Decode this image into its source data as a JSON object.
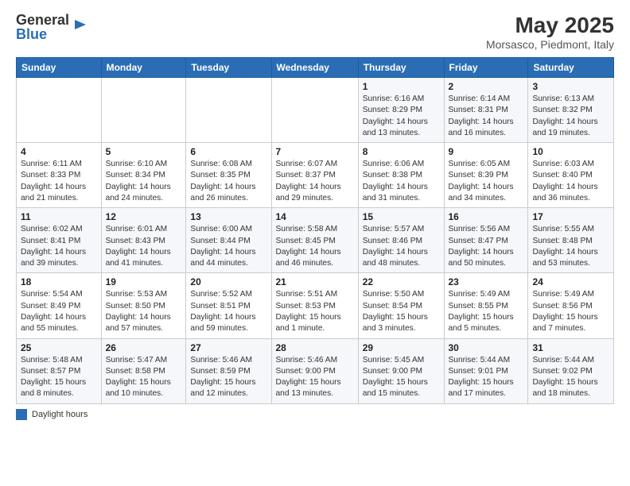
{
  "logo": {
    "general": "General",
    "blue": "Blue"
  },
  "header": {
    "title": "May 2025",
    "subtitle": "Morsasco, Piedmont, Italy"
  },
  "weekdays": [
    "Sunday",
    "Monday",
    "Tuesday",
    "Wednesday",
    "Thursday",
    "Friday",
    "Saturday"
  ],
  "weeks": [
    [
      {
        "date": "",
        "info": ""
      },
      {
        "date": "",
        "info": ""
      },
      {
        "date": "",
        "info": ""
      },
      {
        "date": "",
        "info": ""
      },
      {
        "date": "1",
        "info": "Sunrise: 6:16 AM\nSunset: 8:29 PM\nDaylight: 14 hours and 13 minutes."
      },
      {
        "date": "2",
        "info": "Sunrise: 6:14 AM\nSunset: 8:31 PM\nDaylight: 14 hours and 16 minutes."
      },
      {
        "date": "3",
        "info": "Sunrise: 6:13 AM\nSunset: 8:32 PM\nDaylight: 14 hours and 19 minutes."
      }
    ],
    [
      {
        "date": "4",
        "info": "Sunrise: 6:11 AM\nSunset: 8:33 PM\nDaylight: 14 hours and 21 minutes."
      },
      {
        "date": "5",
        "info": "Sunrise: 6:10 AM\nSunset: 8:34 PM\nDaylight: 14 hours and 24 minutes."
      },
      {
        "date": "6",
        "info": "Sunrise: 6:08 AM\nSunset: 8:35 PM\nDaylight: 14 hours and 26 minutes."
      },
      {
        "date": "7",
        "info": "Sunrise: 6:07 AM\nSunset: 8:37 PM\nDaylight: 14 hours and 29 minutes."
      },
      {
        "date": "8",
        "info": "Sunrise: 6:06 AM\nSunset: 8:38 PM\nDaylight: 14 hours and 31 minutes."
      },
      {
        "date": "9",
        "info": "Sunrise: 6:05 AM\nSunset: 8:39 PM\nDaylight: 14 hours and 34 minutes."
      },
      {
        "date": "10",
        "info": "Sunrise: 6:03 AM\nSunset: 8:40 PM\nDaylight: 14 hours and 36 minutes."
      }
    ],
    [
      {
        "date": "11",
        "info": "Sunrise: 6:02 AM\nSunset: 8:41 PM\nDaylight: 14 hours and 39 minutes."
      },
      {
        "date": "12",
        "info": "Sunrise: 6:01 AM\nSunset: 8:43 PM\nDaylight: 14 hours and 41 minutes."
      },
      {
        "date": "13",
        "info": "Sunrise: 6:00 AM\nSunset: 8:44 PM\nDaylight: 14 hours and 44 minutes."
      },
      {
        "date": "14",
        "info": "Sunrise: 5:58 AM\nSunset: 8:45 PM\nDaylight: 14 hours and 46 minutes."
      },
      {
        "date": "15",
        "info": "Sunrise: 5:57 AM\nSunset: 8:46 PM\nDaylight: 14 hours and 48 minutes."
      },
      {
        "date": "16",
        "info": "Sunrise: 5:56 AM\nSunset: 8:47 PM\nDaylight: 14 hours and 50 minutes."
      },
      {
        "date": "17",
        "info": "Sunrise: 5:55 AM\nSunset: 8:48 PM\nDaylight: 14 hours and 53 minutes."
      }
    ],
    [
      {
        "date": "18",
        "info": "Sunrise: 5:54 AM\nSunset: 8:49 PM\nDaylight: 14 hours and 55 minutes."
      },
      {
        "date": "19",
        "info": "Sunrise: 5:53 AM\nSunset: 8:50 PM\nDaylight: 14 hours and 57 minutes."
      },
      {
        "date": "20",
        "info": "Sunrise: 5:52 AM\nSunset: 8:51 PM\nDaylight: 14 hours and 59 minutes."
      },
      {
        "date": "21",
        "info": "Sunrise: 5:51 AM\nSunset: 8:53 PM\nDaylight: 15 hours and 1 minute."
      },
      {
        "date": "22",
        "info": "Sunrise: 5:50 AM\nSunset: 8:54 PM\nDaylight: 15 hours and 3 minutes."
      },
      {
        "date": "23",
        "info": "Sunrise: 5:49 AM\nSunset: 8:55 PM\nDaylight: 15 hours and 5 minutes."
      },
      {
        "date": "24",
        "info": "Sunrise: 5:49 AM\nSunset: 8:56 PM\nDaylight: 15 hours and 7 minutes."
      }
    ],
    [
      {
        "date": "25",
        "info": "Sunrise: 5:48 AM\nSunset: 8:57 PM\nDaylight: 15 hours and 8 minutes."
      },
      {
        "date": "26",
        "info": "Sunrise: 5:47 AM\nSunset: 8:58 PM\nDaylight: 15 hours and 10 minutes."
      },
      {
        "date": "27",
        "info": "Sunrise: 5:46 AM\nSunset: 8:59 PM\nDaylight: 15 hours and 12 minutes."
      },
      {
        "date": "28",
        "info": "Sunrise: 5:46 AM\nSunset: 9:00 PM\nDaylight: 15 hours and 13 minutes."
      },
      {
        "date": "29",
        "info": "Sunrise: 5:45 AM\nSunset: 9:00 PM\nDaylight: 15 hours and 15 minutes."
      },
      {
        "date": "30",
        "info": "Sunrise: 5:44 AM\nSunset: 9:01 PM\nDaylight: 15 hours and 17 minutes."
      },
      {
        "date": "31",
        "info": "Sunrise: 5:44 AM\nSunset: 9:02 PM\nDaylight: 15 hours and 18 minutes."
      }
    ]
  ],
  "legend": {
    "label": "Daylight hours"
  }
}
